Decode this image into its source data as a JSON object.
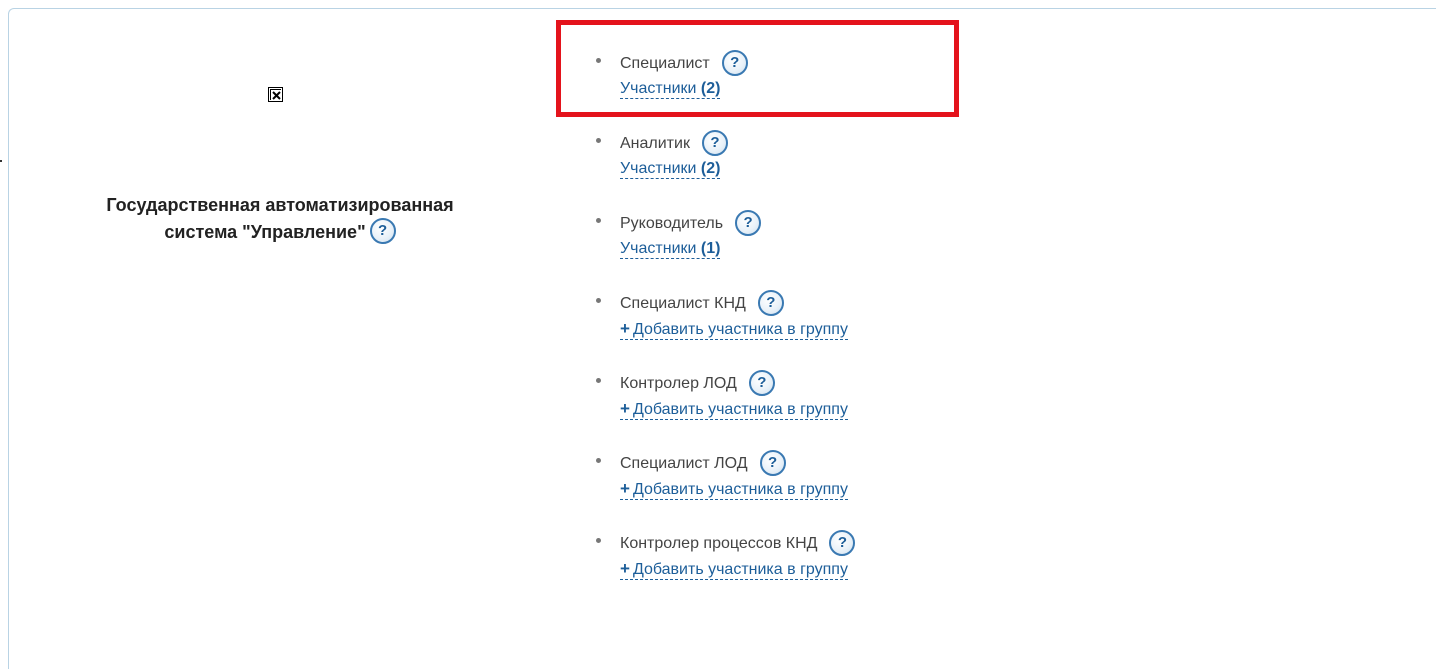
{
  "system": {
    "title_line1": "Государственная автоматизированная",
    "title_line2": "система \"Управление\"",
    "help_glyph": "?"
  },
  "groups": [
    {
      "name": "Специалист",
      "link_text": "Участники",
      "count": "(2)",
      "has_members": true
    },
    {
      "name": "Аналитик",
      "link_text": "Участники",
      "count": "(2)",
      "has_members": true
    },
    {
      "name": "Руководитель",
      "link_text": "Участники",
      "count": "(1)",
      "has_members": true
    },
    {
      "name": "Специалист КНД",
      "link_text": "Добавить участника в группу",
      "plus": "+",
      "has_members": false
    },
    {
      "name": "Контролер ЛОД",
      "link_text": "Добавить участника в группу",
      "plus": "+",
      "has_members": false
    },
    {
      "name": "Специалист ЛОД",
      "link_text": "Добавить участника в группу",
      "plus": "+",
      "has_members": false
    },
    {
      "name": "Контролер процессов КНД",
      "link_text": "Добавить участника в группу",
      "plus": "+",
      "has_members": false
    }
  ],
  "colors": {
    "link": "#1d5e99",
    "highlight": "#e4131c",
    "frame": "#b9d3e4"
  }
}
